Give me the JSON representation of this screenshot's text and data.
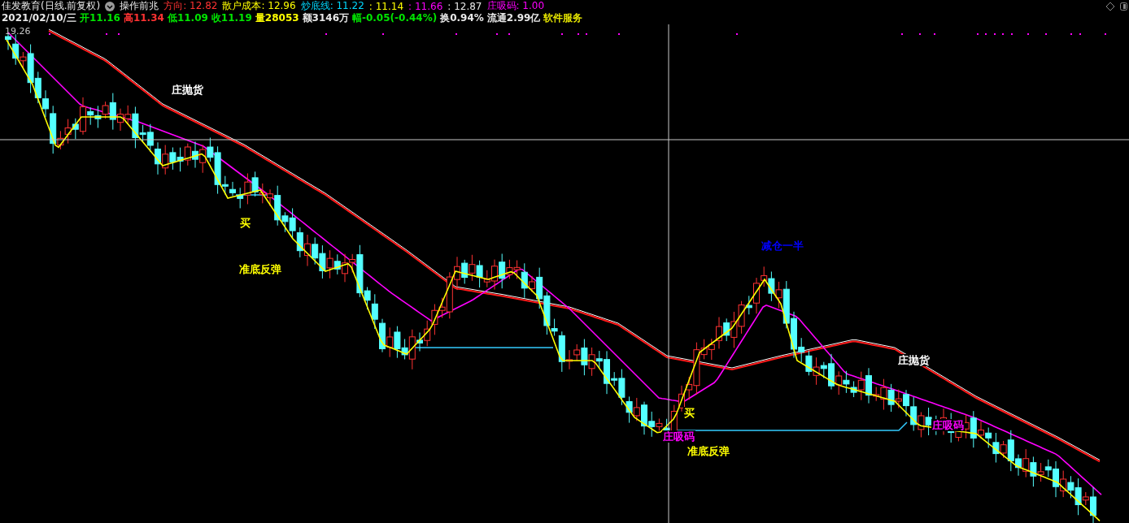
{
  "header": {
    "title": "佳发教育(日线.前复权)",
    "indicator_name": "操作前兆",
    "values": [
      {
        "text": "方向: 12.82",
        "color": "#ff3232"
      },
      {
        "text": "散户成本: 12.96",
        "color": "#ffff00"
      },
      {
        "text": "炒底线: 11.22",
        "color": "#00d8ff"
      },
      {
        "text": ": 11.14",
        "color": "#ffff00"
      },
      {
        "text": ": 11.66",
        "color": "#ff00ff"
      },
      {
        "text": ": 12.87",
        "color": "#e8e8e8"
      },
      {
        "text": "庄吸码: 1.00",
        "color": "#ff00ff"
      }
    ]
  },
  "quote": [
    {
      "text": "2021/02/10/三",
      "color": "#e8e8e8"
    },
    {
      "text": "开11.16",
      "color": "#00e600"
    },
    {
      "text": "高11.34",
      "color": "#ff3232"
    },
    {
      "text": "低11.09",
      "color": "#00e600"
    },
    {
      "text": "收11.19",
      "color": "#00e600"
    },
    {
      "text": "量28053",
      "color": "#ffff00"
    },
    {
      "text": "额3146万",
      "color": "#e8e8e8"
    },
    {
      "text": "幅-0.05(-0.44%)",
      "color": "#00e600"
    },
    {
      "text": "换0.94%",
      "color": "#e8e8e8"
    },
    {
      "text": "流通2.99亿",
      "color": "#e8e8e8"
    },
    {
      "text": "软件服务",
      "color": "#e6e600"
    }
  ],
  "chart": {
    "price_label": "19.26",
    "annotations": [
      {
        "text": "庄抛货",
        "color": "#ffffff"
      },
      {
        "text": "买",
        "color": "#ffff00"
      },
      {
        "text": "准底反弹",
        "color": "#ffff00"
      },
      {
        "text": "减仓一半",
        "color": "#0000ff"
      },
      {
        "text": "买",
        "color": "#ffff00"
      },
      {
        "text": "庄吸码",
        "color": "#ff00ff"
      },
      {
        "text": "准底反弹",
        "color": "#ffff00"
      },
      {
        "text": "庄抛货",
        "color": "#ffffff"
      },
      {
        "text": "庄吸码",
        "color": "#ff00ff"
      }
    ]
  }
}
